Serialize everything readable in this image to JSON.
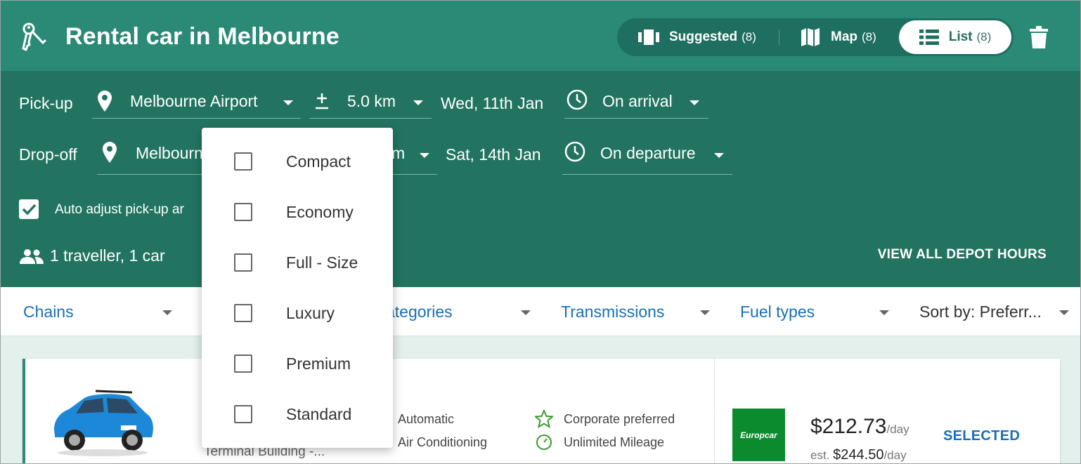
{
  "header": {
    "title": "Rental car in Melbourne",
    "views": [
      {
        "label": "Suggested",
        "count": "(8)",
        "icon": "cards-icon"
      },
      {
        "label": "Map",
        "count": "(8)",
        "icon": "map-icon"
      },
      {
        "label": "List",
        "count": "(8)",
        "icon": "list-icon",
        "active": true
      }
    ]
  },
  "search": {
    "pickup": {
      "label": "Pick-up",
      "location": "Melbourne Airport",
      "radius": "5.0 km",
      "date": "Wed, 11th Jan",
      "time": "On arrival"
    },
    "dropoff": {
      "label": "Drop-off",
      "location": "Melbourn",
      "radius": "m",
      "date": "Sat, 14th Jan",
      "time": "On departure"
    },
    "auto_adjust": {
      "label": "Auto adjust pick-up ar",
      "checked": true
    },
    "travellers": "1 traveller, 1 car",
    "depot_hours": "VIEW ALL DEPOT HOURS"
  },
  "filters": {
    "chains": "Chains",
    "categories": "ategories",
    "transmissions": "Transmissions",
    "fuel_types": "Fuel types",
    "sort": "Sort by: Preferr..."
  },
  "category_dropdown": {
    "options": [
      {
        "label": "Compact",
        "checked": false
      },
      {
        "label": "Economy",
        "checked": false
      },
      {
        "label": "Full - Size",
        "checked": false
      },
      {
        "label": "Luxury",
        "checked": false
      },
      {
        "label": "Premium",
        "checked": false
      },
      {
        "label": "Standard",
        "checked": false
      }
    ]
  },
  "result": {
    "location": "Terminal Building -...",
    "features": [
      "Automatic",
      "Air Conditioning"
    ],
    "perks": [
      "Corporate preferred",
      "Unlimited Mileage"
    ],
    "vendor": "Europcar",
    "price": "$212.73",
    "per_day": "/day",
    "est_prefix": "est.",
    "est_price": "$244.50",
    "est_per_day": "/day",
    "action": "SELECTED"
  },
  "colors": {
    "header": "#2a8a76",
    "panel": "#227461",
    "link": "#1a6fb5",
    "europcar": "#0c8a2e"
  }
}
